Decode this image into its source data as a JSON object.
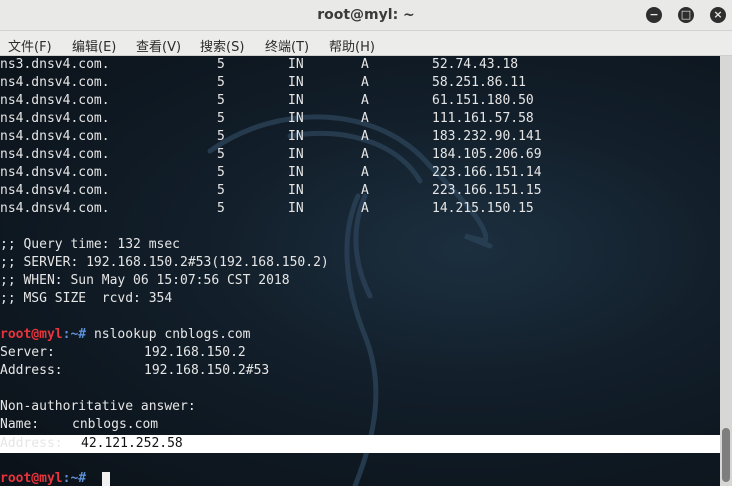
{
  "window": {
    "title": "root@myl: ~"
  },
  "controls": {
    "minimize": "−",
    "maximize": "□",
    "close": "×"
  },
  "menu": [
    "文件(F)",
    "编辑(E)",
    "查看(V)",
    "搜索(S)",
    "终端(T)",
    "帮助(H)"
  ],
  "dns_records": [
    {
      "name": "ns3.dnsv4.com.",
      "ttl": "5",
      "class": "IN",
      "type": "A",
      "address": "52.74.43.18"
    },
    {
      "name": "ns4.dnsv4.com.",
      "ttl": "5",
      "class": "IN",
      "type": "A",
      "address": "58.251.86.11"
    },
    {
      "name": "ns4.dnsv4.com.",
      "ttl": "5",
      "class": "IN",
      "type": "A",
      "address": "61.151.180.50"
    },
    {
      "name": "ns4.dnsv4.com.",
      "ttl": "5",
      "class": "IN",
      "type": "A",
      "address": "111.161.57.58"
    },
    {
      "name": "ns4.dnsv4.com.",
      "ttl": "5",
      "class": "IN",
      "type": "A",
      "address": "183.232.90.141"
    },
    {
      "name": "ns4.dnsv4.com.",
      "ttl": "5",
      "class": "IN",
      "type": "A",
      "address": "184.105.206.69"
    },
    {
      "name": "ns4.dnsv4.com.",
      "ttl": "5",
      "class": "IN",
      "type": "A",
      "address": "223.166.151.14"
    },
    {
      "name": "ns4.dnsv4.com.",
      "ttl": "5",
      "class": "IN",
      "type": "A",
      "address": "223.166.151.15"
    },
    {
      "name": "ns4.dnsv4.com.",
      "ttl": "5",
      "class": "IN",
      "type": "A",
      "address": "14.215.150.15"
    }
  ],
  "query_info": {
    "time": ";; Query time: 132 msec",
    "server": ";; SERVER: 192.168.150.2#53(192.168.150.2)",
    "when": ";; WHEN: Sun May 06 15:07:56 CST 2018",
    "size": ";; MSG SIZE  rcvd: 354"
  },
  "prompt": {
    "user": "root@myl",
    "sep": ":~# "
  },
  "command": "nslookup cnblogs.com",
  "nslookup": {
    "server_label": "Server:",
    "server_value": "192.168.150.2",
    "address_label": "Address:",
    "address_value": "192.168.150.2#53",
    "non_auth": "Non-authoritative answer:",
    "name_label": "Name:",
    "name_value": "cnblogs.com",
    "result_label": "Address:",
    "result_value": "42.121.252.58"
  }
}
